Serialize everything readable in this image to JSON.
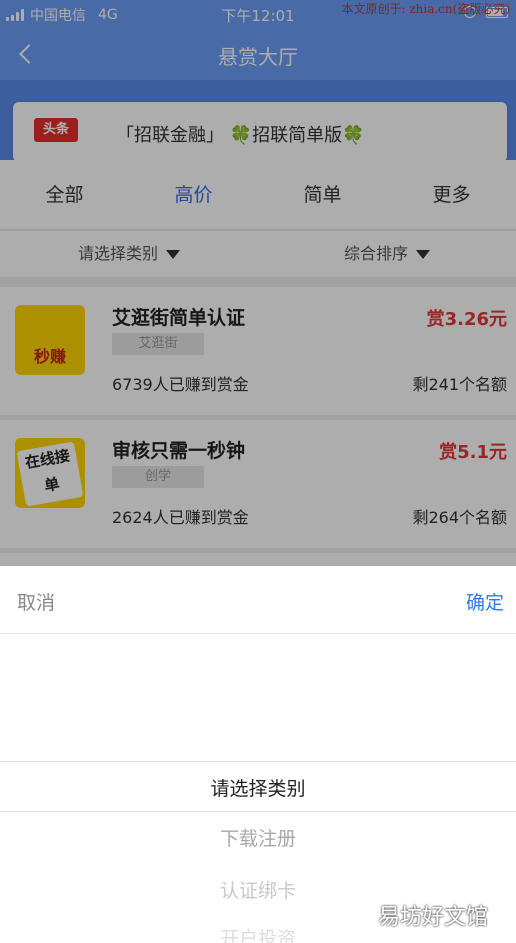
{
  "status": {
    "carrier": "中国电信",
    "network": "4G",
    "time": "下午12:01",
    "watermark": "本文原创于: zhia.cn(盗版必究)"
  },
  "nav": {
    "title": "悬赏大厅"
  },
  "banner": {
    "tag": "头条",
    "text_a": "「招联金融」",
    "clover": "🍀",
    "text_b": "招联简单版"
  },
  "tabs": [
    {
      "label": "全部"
    },
    {
      "label": "高价"
    },
    {
      "label": "简单"
    },
    {
      "label": "更多"
    }
  ],
  "filters": {
    "category": "请选择类别",
    "sort": "综合排序"
  },
  "tasks": [
    {
      "thumb_text": "秒赚",
      "name": "艾逛街简单认证",
      "category": "艾逛街",
      "reward": "赏3.26元",
      "earned": "6739人已赚到赏金",
      "remaining": "剩241个名额"
    },
    {
      "thumb_text": "在线接单",
      "name": "审核只需一秒钟",
      "category": "创学",
      "reward": "赏5.1元",
      "earned": "2624人已赚到赏金",
      "remaining": "剩264个名额"
    }
  ],
  "picker": {
    "cancel": "取消",
    "confirm": "确定",
    "options": [
      "请选择类别",
      "下载注册",
      "认证绑卡",
      "开户投资"
    ],
    "selected": "请选择类别"
  },
  "corner_watermark": "易坊好文馆",
  "colors": {
    "primary": "#6b9cf5",
    "active_tab": "#2d6fe0",
    "reward": "#e23838",
    "confirm": "#2d7be5"
  }
}
